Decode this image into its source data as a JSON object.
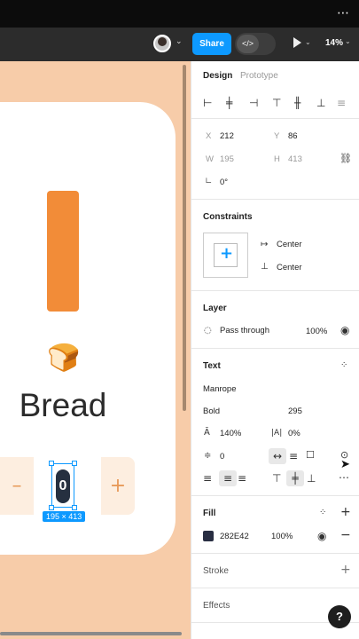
{
  "toolbar": {
    "share_label": "Share",
    "code_icon": "</>",
    "play_icon": "play-icon",
    "zoom": "14%"
  },
  "canvas": {
    "product_name": "Bread",
    "emoji": "🍞",
    "minus": "–",
    "plus": "+",
    "quantity": "0",
    "size_badge": "195 × 413",
    "colors": {
      "background": "#f7cca9",
      "bar": "#f28c38",
      "stepper": "#fdeee0"
    }
  },
  "panel": {
    "tabs": {
      "design": "Design",
      "prototype": "Prototype"
    },
    "x_label": "X",
    "x_value": "212",
    "y_label": "Y",
    "y_value": "86",
    "w_label": "W",
    "w_value": "195",
    "h_label": "H",
    "h_value": "413",
    "rotation": "0°",
    "constraints": {
      "title": "Constraints",
      "horizontal": "Center",
      "vertical": "Center"
    },
    "layer": {
      "title": "Layer",
      "blend": "Pass through",
      "opacity": "100%"
    },
    "text": {
      "title": "Text",
      "font": "Manrope",
      "weight": "Bold",
      "size": "295",
      "line_height": "140%",
      "letter_spacing": "0%",
      "paragraph_spacing": "0"
    },
    "fill": {
      "title": "Fill",
      "hex": "282E42",
      "opacity": "100%",
      "swatch": "#282e42"
    },
    "stroke": {
      "title": "Stroke"
    },
    "effects": {
      "title": "Effects"
    },
    "help": "?"
  }
}
